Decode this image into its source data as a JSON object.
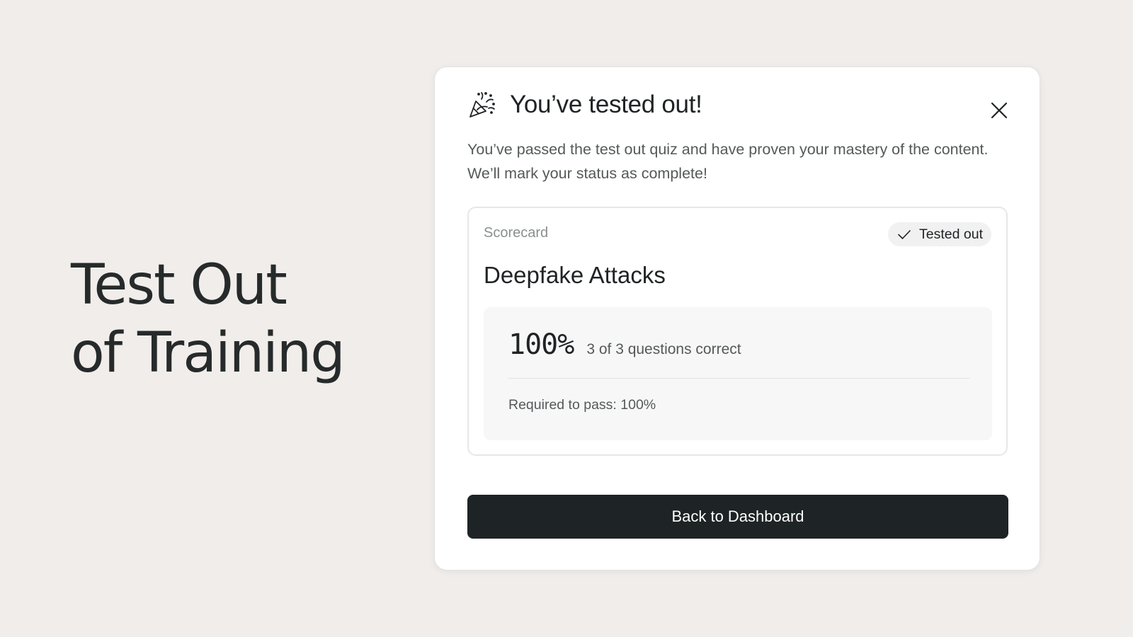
{
  "hero": {
    "line1": "Test Out",
    "line2": "of Training"
  },
  "modal": {
    "icon": "party-popper-icon",
    "title": "You’ve tested out!",
    "close_icon": "close-icon",
    "description": "You’ve passed the test out quiz and have proven your mastery of the content. We’ll mark your status as complete!",
    "scorecard": {
      "label": "Scorecard",
      "badge": {
        "icon": "checkmark-icon",
        "label": "Tested out"
      },
      "course_title": "Deepfake Attacks",
      "score_percent": "100%",
      "score_detail": "3 of 3 questions correct",
      "required_to_pass": "Required to pass: 100%"
    },
    "primary_button_label": "Back to Dashboard"
  },
  "colors": {
    "page_background": "#f0edea",
    "card_background": "#ffffff",
    "button_background": "#1e2425",
    "button_text": "#ffffff",
    "badge_background": "#f1f1f1",
    "score_box_background": "#f7f7f7"
  }
}
